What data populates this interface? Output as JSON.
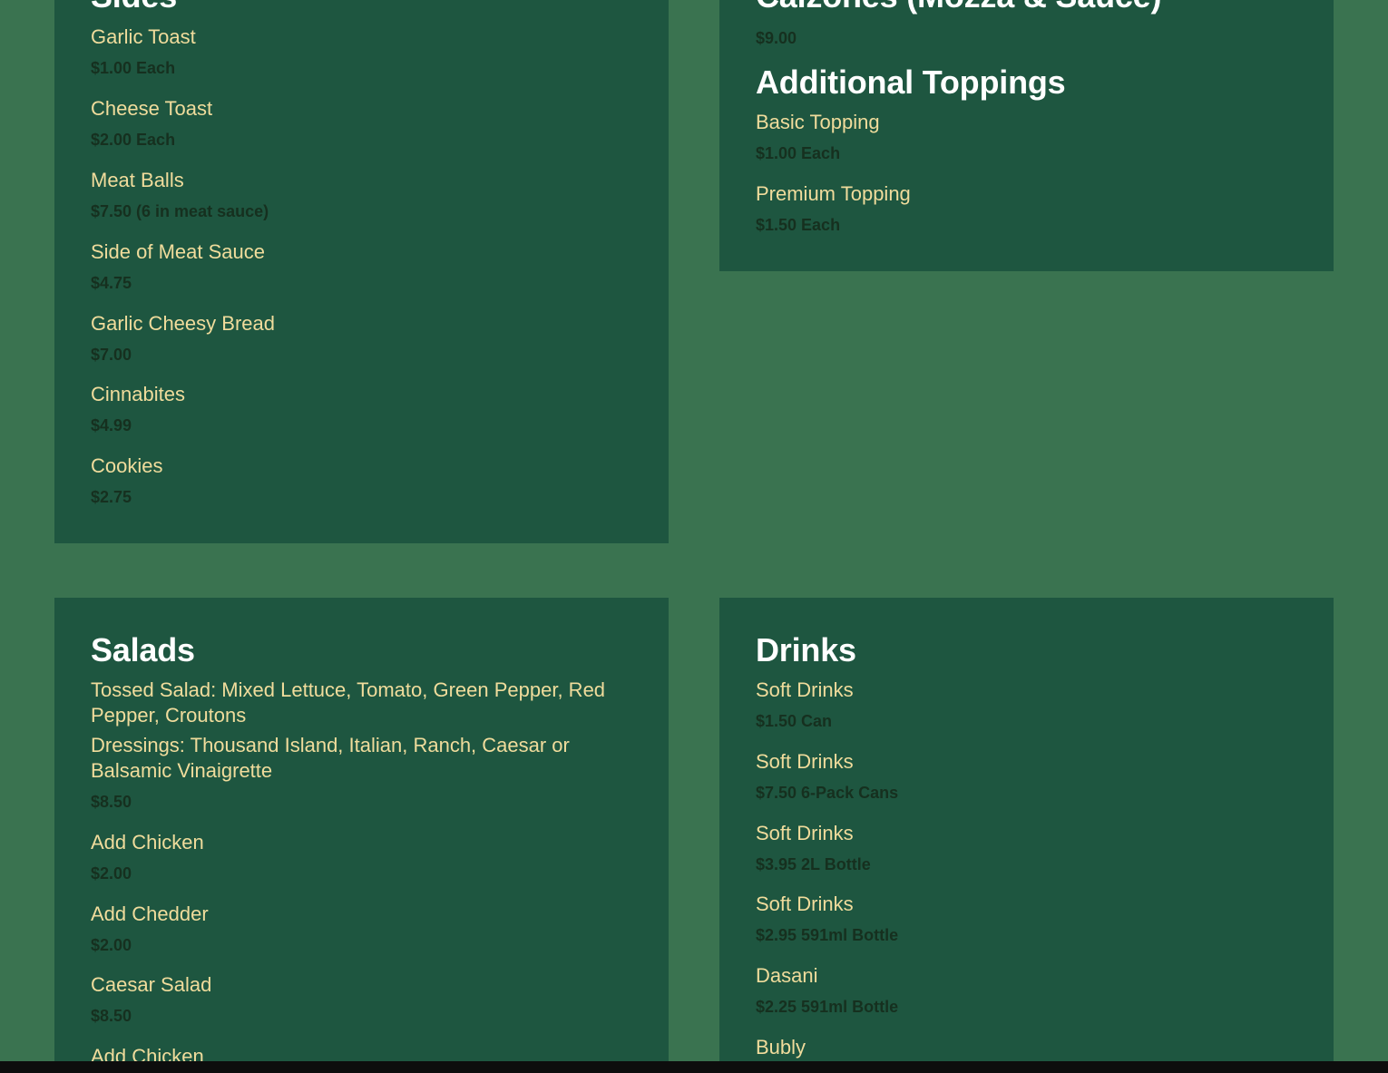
{
  "colors": {
    "page_background": "#3a7350",
    "panel_background": "#1e5640",
    "heading_text": "#ffffff",
    "item_name_text": "#f0dc9c",
    "price_text": "#16301f"
  },
  "sides": {
    "title": "Sides",
    "items": [
      {
        "name": "Garlic Toast",
        "price": "$1.00 Each"
      },
      {
        "name": "Cheese Toast",
        "price": "$2.00 Each"
      },
      {
        "name": "Meat Balls",
        "price": "$7.50 (6 in meat sauce)"
      },
      {
        "name": "Side of Meat Sauce",
        "price": "$4.75"
      },
      {
        "name": "Garlic Cheesy Bread",
        "price": "$7.00"
      },
      {
        "name": "Cinnabites",
        "price": "$4.99"
      },
      {
        "name": "Cookies",
        "price": "$2.75"
      }
    ]
  },
  "calzones": {
    "title": "Calzones (Mozza & Sauce)",
    "price": "$9.00"
  },
  "toppings": {
    "title": "Additional Toppings",
    "items": [
      {
        "name": "Basic Topping",
        "price": "$1.00 Each"
      },
      {
        "name": "Premium Topping",
        "price": "$1.50 Each"
      }
    ]
  },
  "salads": {
    "title": "Salads",
    "tossed_description": "Tossed Salad: Mixed Lettuce, Tomato, Green Pepper, Red Pepper, Croutons",
    "dressings_description": "Dressings: Thousand Island, Italian, Ranch, Caesar or Balsamic Vinaigrette",
    "tossed_price": "$8.50",
    "items": [
      {
        "name": "Add Chicken",
        "price": "$2.00"
      },
      {
        "name": "Add Chedder",
        "price": "$2.00"
      },
      {
        "name": "Caesar Salad",
        "price": "$8.50"
      },
      {
        "name": "Add Chicken"
      }
    ]
  },
  "drinks": {
    "title": "Drinks",
    "items": [
      {
        "name": "Soft Drinks",
        "price": "$1.50 Can"
      },
      {
        "name": "Soft Drinks",
        "price": "$7.50 6-Pack Cans"
      },
      {
        "name": "Soft Drinks",
        "price": "$3.95 2L Bottle"
      },
      {
        "name": "Soft Drinks",
        "price": "$2.95 591ml Bottle"
      },
      {
        "name": "Dasani",
        "price": "$2.25 591ml Bottle"
      },
      {
        "name": "Bubly"
      }
    ]
  }
}
